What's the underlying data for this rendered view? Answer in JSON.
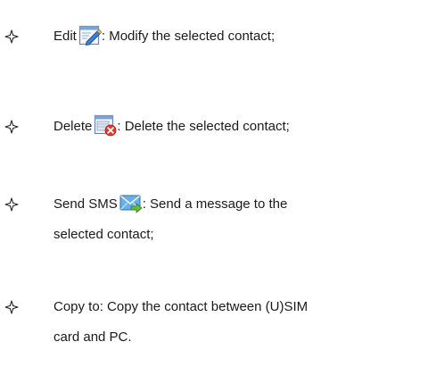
{
  "bullet_symbol": "✧",
  "items": [
    {
      "label": "Edit",
      "icon": "edit-icon",
      "description": ": Modify the selected contact;"
    },
    {
      "label": "Delete",
      "icon": "delete-icon",
      "description": ": Delete the selected contact;"
    },
    {
      "label": "Send SMS",
      "icon": "send-sms-icon",
      "description_line1": ": Send a message to the",
      "description_line2": "selected contact;"
    },
    {
      "label_line1": "Copy to: Copy the contact between (U)SIM",
      "label_line2": "card and PC."
    }
  ]
}
